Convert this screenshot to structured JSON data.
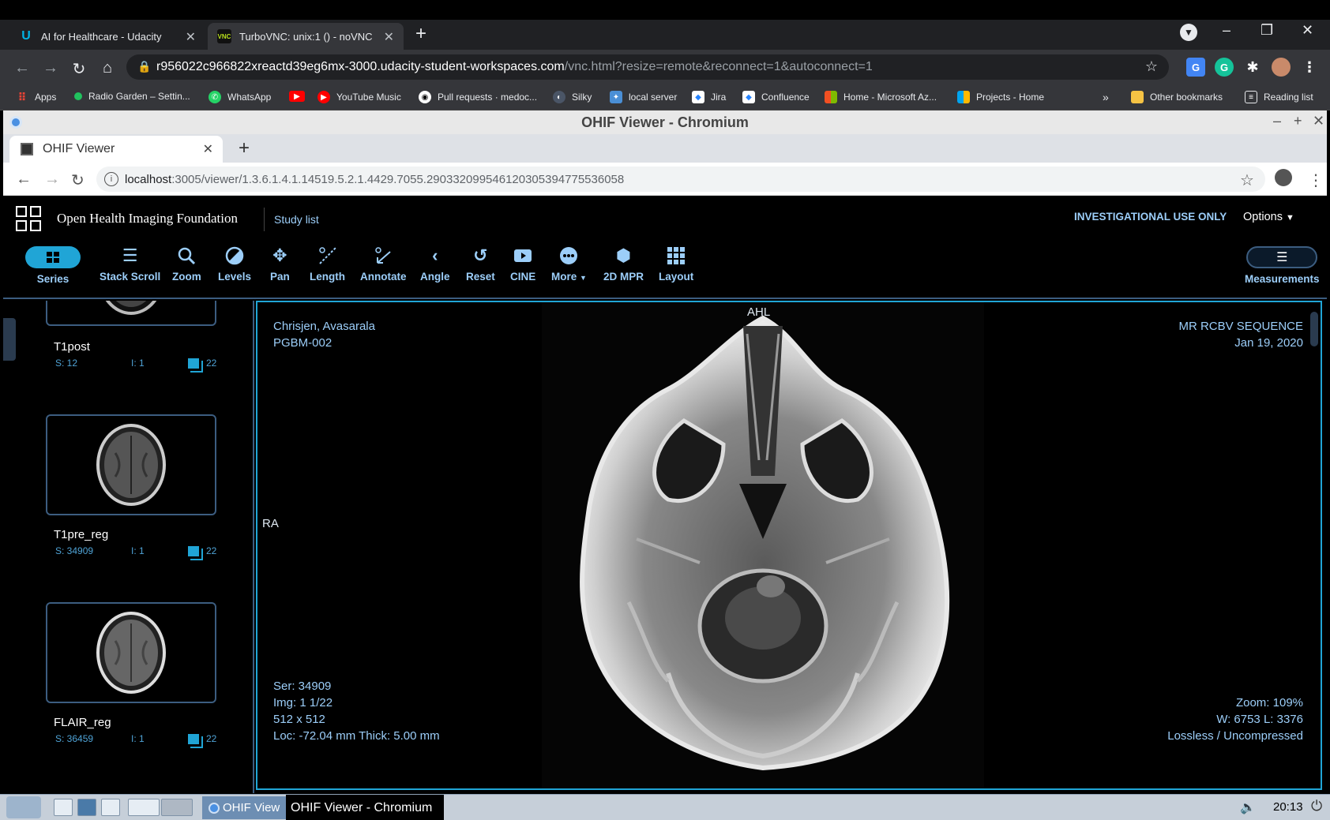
{
  "outer_browser": {
    "tabs": [
      {
        "title": "AI for Healthcare - Udacity",
        "icon": "udacity-icon"
      },
      {
        "title": "TurboVNC: unix:1 () - noVNC",
        "icon": "vnc-icon"
      }
    ],
    "url_host": "r956022c966822xreactd39eg6mx-3000.udacity-student-workspaces.com",
    "url_rest": "/vnc.html?resize=remote&reconnect=1&autoconnect=1",
    "bookmarks": [
      "Apps",
      "Radio Garden – Settin...",
      "WhatsApp",
      "",
      "YouTube Music",
      "Pull requests · medoc...",
      "Silky",
      "local server",
      "Jira",
      "Confluence",
      "Home - Microsoft Az...",
      "Projects - Home"
    ],
    "bookmarks_more": "»",
    "other_bookmarks": "Other bookmarks",
    "reading_list": "Reading list"
  },
  "inner_browser": {
    "window_title": "OHIF Viewer - Chromium",
    "tab_title": "OHIF Viewer",
    "url_host": "localhost",
    "url_rest": ":3005/viewer/1.3.6.1.4.1.14519.5.2.1.4429.7055.290332099546120305394775536058"
  },
  "app": {
    "name": "Open Health Imaging Foundation",
    "study_list": "Study list",
    "investigational": "INVESTIGATIONAL USE ONLY",
    "options": "Options",
    "tools": {
      "series": "Series",
      "stack_scroll": "Stack Scroll",
      "zoom": "Zoom",
      "levels": "Levels",
      "pan": "Pan",
      "length": "Length",
      "annotate": "Annotate",
      "angle": "Angle",
      "reset": "Reset",
      "cine": "CINE",
      "more": "More",
      "mpr": "2D MPR",
      "layout": "Layout",
      "measurements": "Measurements"
    },
    "series": [
      {
        "name": "T1post",
        "s": "S: 12",
        "i": "I: 1",
        "count": "22"
      },
      {
        "name": "T1pre_reg",
        "s": "S: 34909",
        "i": "I: 1",
        "count": "22"
      },
      {
        "name": "FLAIR_reg",
        "s": "S: 36459",
        "i": "I: 1",
        "count": "22"
      }
    ],
    "viewport": {
      "patient_name": "Chrisjen, Avasarala",
      "patient_id": "PGBM-002",
      "study_desc": "MR RCBV SEQUENCE",
      "study_date": "Jan 19, 2020",
      "orient_top": "AHL",
      "orient_left": "RA",
      "ser": "Ser: 34909",
      "img": "Img: 1 1/22",
      "dims": "512 x 512",
      "loc": "Loc: -72.04 mm Thick: 5.00 mm",
      "zoom": "Zoom: 109%",
      "wl": "W: 6753 L: 3376",
      "compression": "Lossless / Uncompressed"
    }
  },
  "taskbar": {
    "task1": "OHIF View",
    "task2": "OHIF Viewer - Chromium",
    "clock": "20:13"
  },
  "colors": {
    "accent": "#20a5d6",
    "text_blue": "#9ccef9",
    "border_blue": "#3c5d80"
  }
}
